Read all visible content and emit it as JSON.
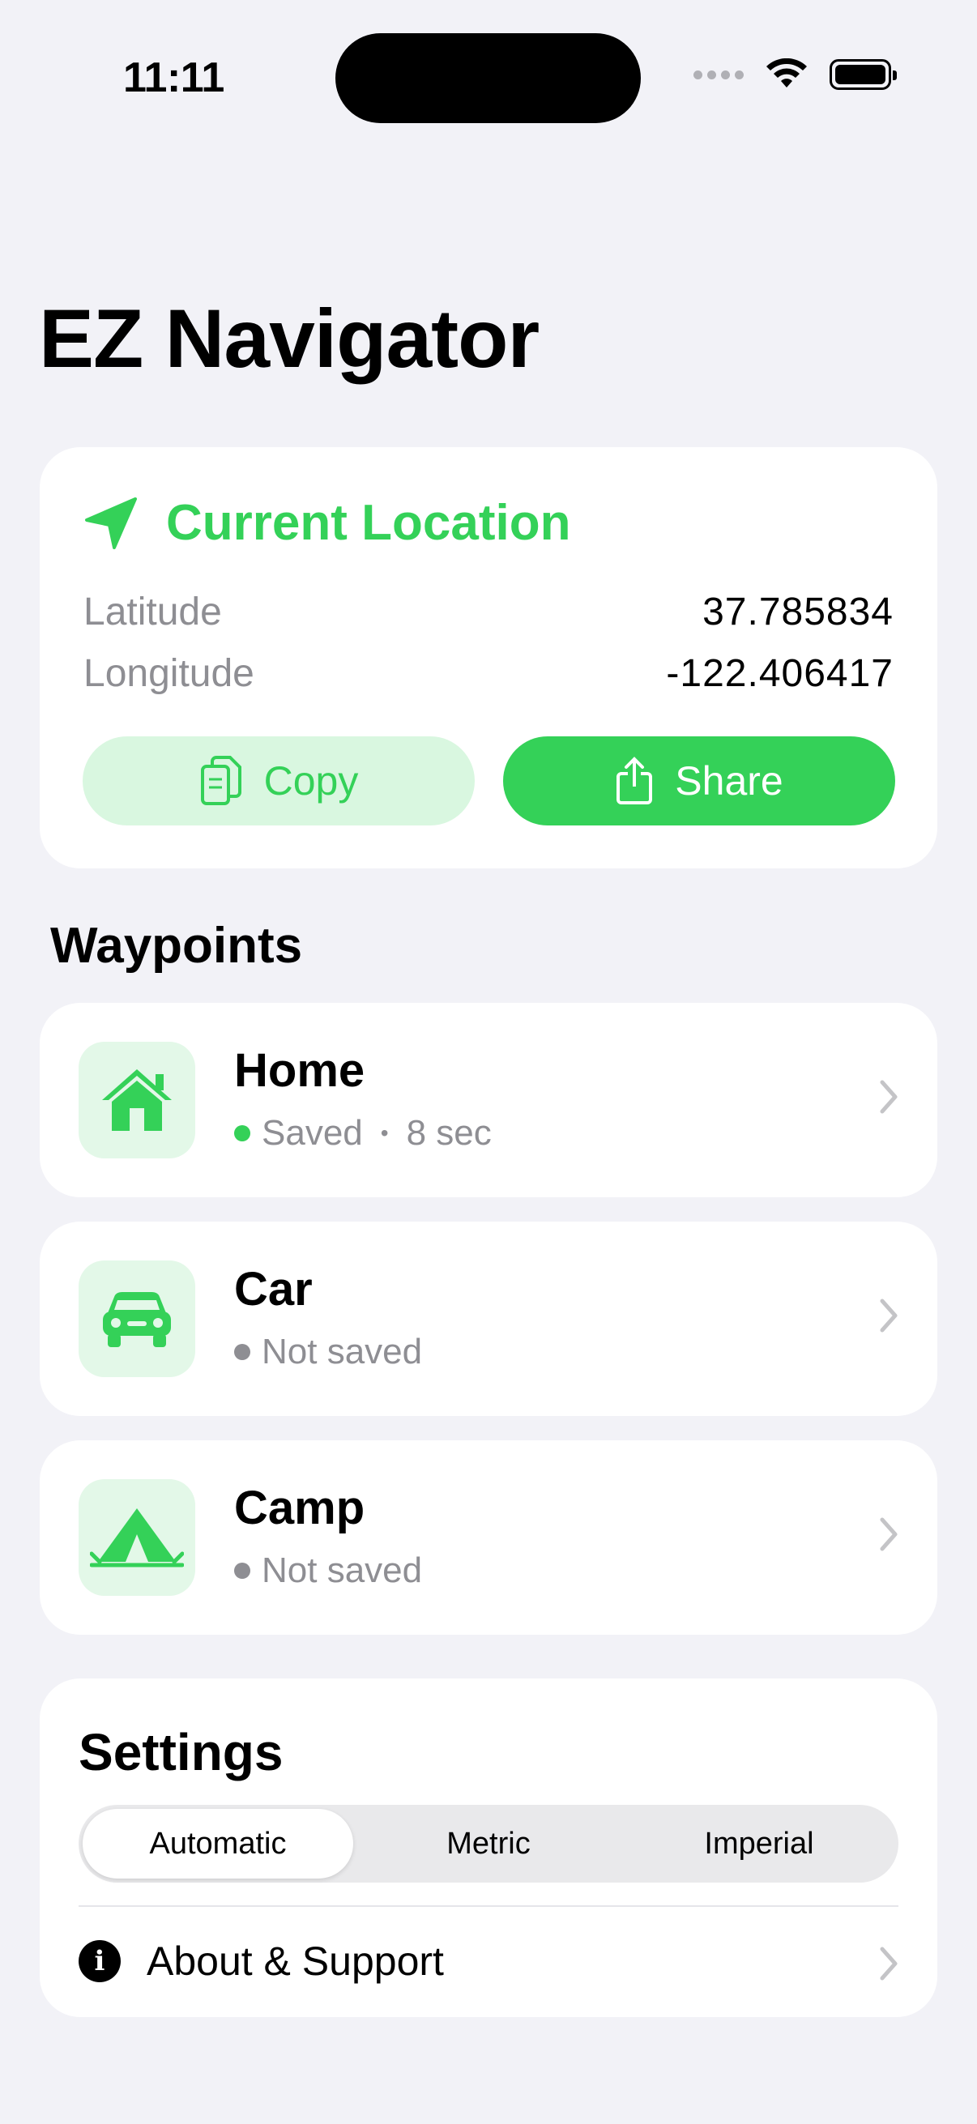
{
  "status_bar": {
    "time": "11:11",
    "icons": [
      "cellular-dots-icon",
      "wifi-icon",
      "battery-icon"
    ]
  },
  "app": {
    "title": "EZ Navigator"
  },
  "location": {
    "title": "Current Location",
    "icon": "location-arrow-icon",
    "latitude_label": "Latitude",
    "latitude_value": "37.785834",
    "longitude_label": "Longitude",
    "longitude_value": "-122.406417",
    "copy_label": "Copy",
    "share_label": "Share"
  },
  "waypoints": {
    "title": "Waypoints",
    "items": [
      {
        "name": "Home",
        "status": "Saved",
        "age": "8 sec",
        "icon": "house-icon",
        "saved": true
      },
      {
        "name": "Car",
        "status": "Not saved",
        "icon": "car-icon",
        "saved": false
      },
      {
        "name": "Camp",
        "status": "Not saved",
        "icon": "tent-icon",
        "saved": false
      }
    ]
  },
  "settings": {
    "title": "Settings",
    "units": [
      "Automatic",
      "Metric",
      "Imperial"
    ],
    "selected_unit": "Automatic",
    "about_label": "About & Support"
  },
  "colors": {
    "accent": "#34d158",
    "accent_light": "#d9f7e0",
    "background": "#f2f2f7",
    "secondary_text": "#8e8e93"
  }
}
